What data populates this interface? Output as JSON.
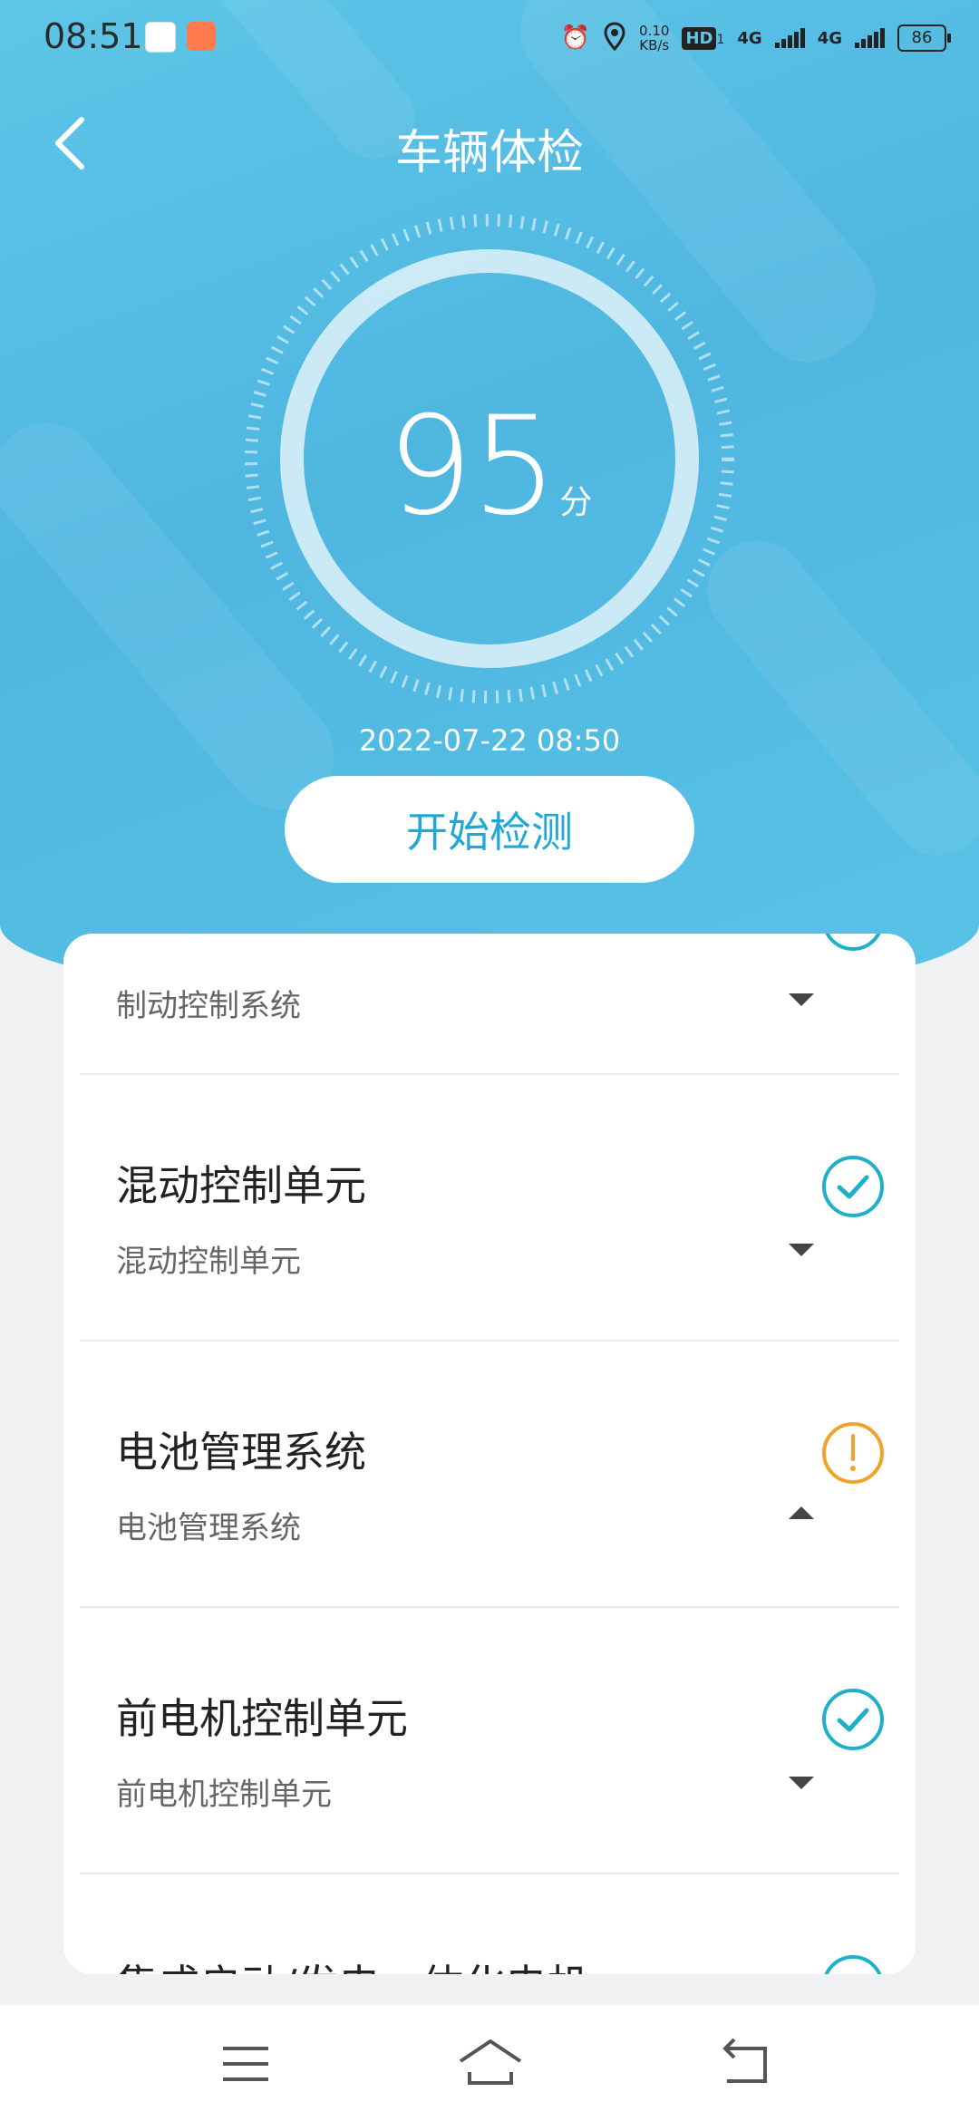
{
  "status_bar": {
    "time": "08:51",
    "speed_value": "0.10",
    "speed_unit": "KB/s",
    "hd_label": "HD",
    "hd_sub": "1",
    "net1": "4G",
    "net2": "4G",
    "battery": "86"
  },
  "header": {
    "title": "车辆体检"
  },
  "score": {
    "value": "95",
    "unit": "分",
    "timestamp": "2022-07-22 08:50"
  },
  "start_button": {
    "label": "开始检测"
  },
  "items": [
    {
      "title": "",
      "subtitle": "制动控制系统",
      "status": "ok",
      "expanded": false
    },
    {
      "title": "混动控制单元",
      "subtitle": "混动控制单元",
      "status": "ok",
      "expanded": false
    },
    {
      "title": "电池管理系统",
      "subtitle": "电池管理系统",
      "status": "warning",
      "expanded": true
    },
    {
      "title": "前电机控制单元",
      "subtitle": "前电机控制单元",
      "status": "ok",
      "expanded": false
    },
    {
      "title": "集成启动/发电一体化电机",
      "subtitle": "",
      "status": "ok",
      "expanded": false
    }
  ],
  "colors": {
    "accent": "#1fa8d4",
    "ok": "#1fb0c9",
    "warning": "#f0a32a",
    "hero": "#4fb6e0"
  },
  "icons": {
    "back": "chevron-left-icon",
    "ok": "check-circle-icon",
    "warning": "exclamation-circle-icon",
    "menu": "menu-icon",
    "home": "home-icon",
    "return": "return-icon"
  }
}
